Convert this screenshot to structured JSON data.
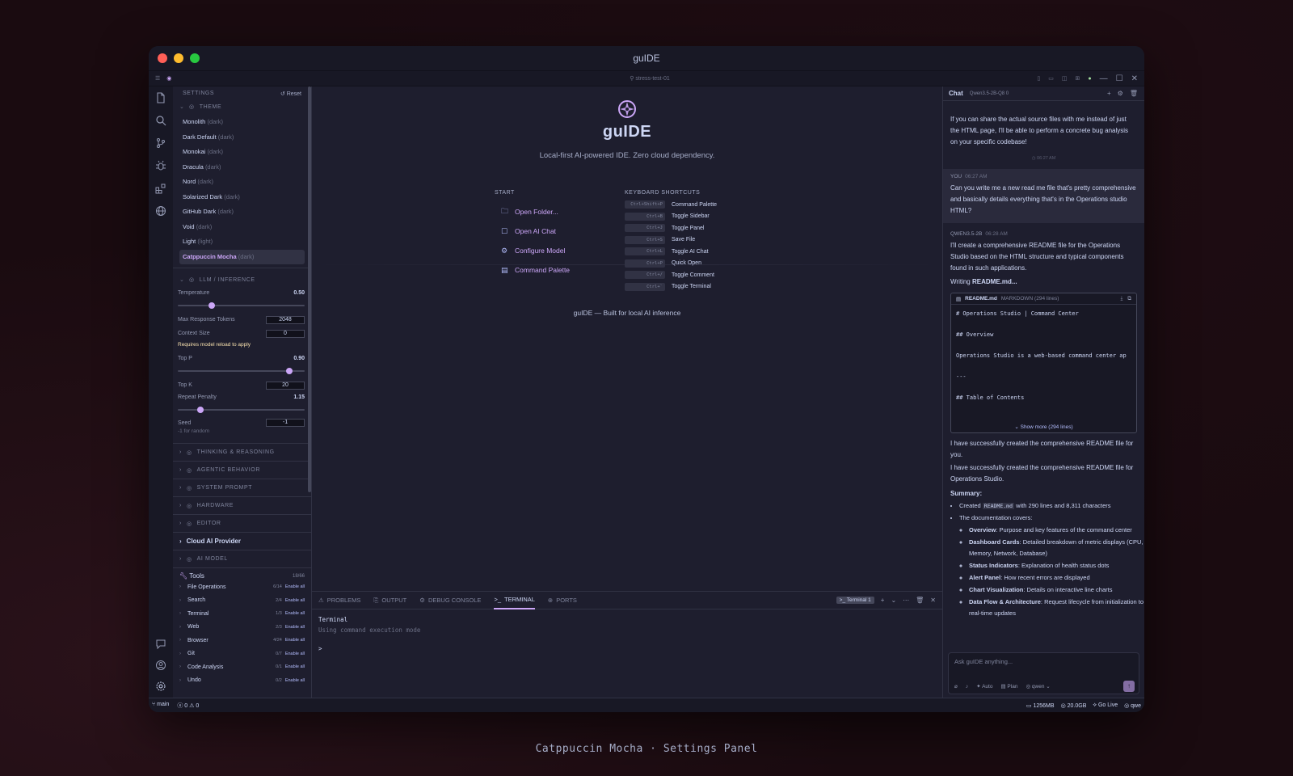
{
  "window": {
    "title": "guIDE"
  },
  "menubar": {
    "search": "stress-test-01"
  },
  "settings": {
    "header": "SETTINGS",
    "reset": "Reset",
    "theme_section": "THEME",
    "themes": [
      {
        "name": "Monolith",
        "kind": "(dark)"
      },
      {
        "name": "Dark Default",
        "kind": "(dark)"
      },
      {
        "name": "Monokai",
        "kind": "(dark)"
      },
      {
        "name": "Dracula",
        "kind": "(dark)"
      },
      {
        "name": "Nord",
        "kind": "(dark)"
      },
      {
        "name": "Solarized Dark",
        "kind": "(dark)"
      },
      {
        "name": "GitHub Dark",
        "kind": "(dark)"
      },
      {
        "name": "Void",
        "kind": "(dark)"
      },
      {
        "name": "Light",
        "kind": "(light)"
      },
      {
        "name": "Catppuccin Mocha",
        "kind": "(dark)"
      }
    ],
    "active_theme": "Catppuccin Mocha",
    "llm_section": "LLM / INFERENCE",
    "temperature": {
      "label": "Temperature",
      "value": "0.50",
      "fraction": 0.27
    },
    "max_tokens": {
      "label": "Max Response Tokens",
      "value": "2048"
    },
    "context_size": {
      "label": "Context Size",
      "value": "0",
      "warning": "Requires model reload to apply"
    },
    "top_p": {
      "label": "Top P",
      "value": "0.90",
      "fraction": 0.88
    },
    "top_k": {
      "label": "Top K",
      "value": "20"
    },
    "repeat_penalty": {
      "label": "Repeat Penalty",
      "value": "1.15",
      "fraction": 0.18
    },
    "seed": {
      "label": "Seed",
      "value": "-1",
      "hint": "-1 for random"
    },
    "sections": [
      {
        "label": "THINKING & REASONING",
        "icon": "brain-icon"
      },
      {
        "label": "AGENTIC BEHAVIOR",
        "icon": "sparkle-icon"
      },
      {
        "label": "SYSTEM PROMPT",
        "icon": "text-icon"
      },
      {
        "label": "HARDWARE",
        "icon": "monitor-icon"
      },
      {
        "label": "EDITOR",
        "icon": "file-icon"
      }
    ],
    "cloud_provider": "Cloud AI Provider",
    "ai_model": "AI MODEL",
    "tools": {
      "label": "Tools",
      "count": "18/66",
      "enable_label": "Enable all",
      "items": [
        {
          "name": "File Operations",
          "count": "6/14"
        },
        {
          "name": "Search",
          "count": "2/4"
        },
        {
          "name": "Terminal",
          "count": "1/3"
        },
        {
          "name": "Web",
          "count": "2/3"
        },
        {
          "name": "Browser",
          "count": "4/24"
        },
        {
          "name": "Git",
          "count": "0/7"
        },
        {
          "name": "Code Analysis",
          "count": "0/1"
        },
        {
          "name": "Undo",
          "count": "0/2"
        }
      ]
    }
  },
  "welcome": {
    "brand": "guIDE",
    "tagline": "Local-first AI-powered IDE. Zero cloud dependency.",
    "start_heading": "START",
    "start_links": [
      {
        "label": "Open Folder...",
        "icon": "folder-icon"
      },
      {
        "label": "Open AI Chat",
        "icon": "chat-icon"
      },
      {
        "label": "Configure Model",
        "icon": "gear-icon"
      },
      {
        "label": "Command Palette",
        "icon": "document-icon"
      }
    ],
    "shortcuts_heading": "KEYBOARD SHORTCUTS",
    "shortcuts": [
      {
        "key": "Ctrl+Shift+P",
        "label": "Command Palette"
      },
      {
        "key": "Ctrl+B",
        "label": "Toggle Sidebar"
      },
      {
        "key": "Ctrl+J",
        "label": "Toggle Panel"
      },
      {
        "key": "Ctrl+S",
        "label": "Save File"
      },
      {
        "key": "Ctrl+L",
        "label": "Toggle AI Chat"
      },
      {
        "key": "Ctrl+P",
        "label": "Quick Open"
      },
      {
        "key": "Ctrl+/",
        "label": "Toggle Comment"
      },
      {
        "key": "Ctrl+`",
        "label": "Toggle Terminal"
      }
    ],
    "footnote": "guIDE — Built for local AI inference"
  },
  "panel": {
    "tabs": [
      {
        "label": "PROBLEMS",
        "icon": "warning-icon"
      },
      {
        "label": "OUTPUT",
        "icon": "output-icon"
      },
      {
        "label": "DEBUG CONSOLE",
        "icon": "bug-icon"
      },
      {
        "label": "TERMINAL",
        "icon": "terminal-icon"
      },
      {
        "label": "PORTS",
        "icon": "globe-icon"
      }
    ],
    "active_tab": "TERMINAL",
    "terminal_instance": "Terminal 1",
    "terminal_lines": [
      "Terminal",
      "Using command execution mode",
      ">"
    ]
  },
  "chat": {
    "title": "Chat",
    "model": "Qwen3.5-2B-Q8 0",
    "prior_text": "If you can share the actual source files with me instead of just the HTML page, I'll be able to perform a concrete bug analysis on your specific codebase!",
    "stamp": "06:27 AM",
    "user_label": "YOU",
    "user_time": "06:27 AM",
    "user_message": "Can you write me a new read me file that's pretty comprehensive and basically details everything that's in the Operations studio HTML?",
    "assistant_label": "QWEN3.5-2B",
    "assistant_time": "06:28 AM",
    "assistant_intro": "I'll create a comprehensive README file for the Operations Studio based on the HTML structure and typical components found in such applications.",
    "writing": "Writing",
    "writing_file": "README.md...",
    "file": {
      "name": "README.md",
      "lang": "MARKDOWN (294 lines)",
      "lines": [
        "# Operations Studio | Command Center",
        "",
        "## Overview",
        "",
        "Operations Studio is a web-based command center ap",
        "",
        "---",
        "",
        "## Table of Contents"
      ],
      "show_more": "Show more (294 lines)"
    },
    "done1": "I have successfully created the comprehensive README file for you.",
    "done2": "I have successfully created the comprehensive README file for Operations Studio.",
    "summary_label": "Summary:",
    "created_prefix": "Created",
    "created_file": "README.md",
    "created_suffix": "with 290 lines and 8,311 characters",
    "covers": "The documentation covers:",
    "bullets": [
      {
        "b": "Overview",
        "t": ": Purpose and key features of the command center"
      },
      {
        "b": "Dashboard Cards",
        "t": ": Detailed breakdown of metric displays (CPU, Memory, Network, Database)"
      },
      {
        "b": "Status Indicators",
        "t": ": Explanation of health status dots"
      },
      {
        "b": "Alert Panel",
        "t": ": How recent errors are displayed"
      },
      {
        "b": "Chart Visualization",
        "t": ": Details on interactive line charts"
      },
      {
        "b": "Data Flow & Architecture",
        "t": ": Request lifecycle from initialization to real-time updates"
      }
    ],
    "input_placeholder": "Ask guIDE anything...",
    "mode_auto": "Auto",
    "mode_plan": "Plan",
    "model_select": "qwen"
  },
  "status": {
    "branch": "main",
    "errors": "0",
    "warnings": "0",
    "memory": "1256MB",
    "disk": "20.0GB",
    "live": "Go Live",
    "model": "qwe"
  },
  "caption": "Catppuccin Mocha · Settings Panel",
  "colors": {
    "accent": "#cba6f7",
    "base": "#1e1e2e",
    "mantle": "#181825"
  }
}
